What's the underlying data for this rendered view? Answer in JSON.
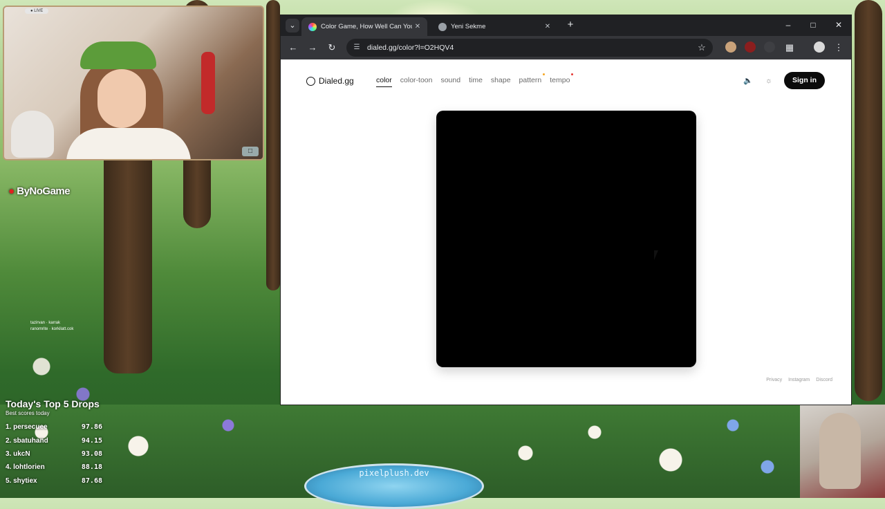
{
  "stream": {
    "live_badge": "● LIVE",
    "brand": "ByNoGame",
    "chat": [
      "tazirvan · karrak",
      "ranomrite · korkilatt.cok"
    ],
    "pool_label": "pixelplush.dev",
    "leaderboard": {
      "title": "Today's Top 5 Drops",
      "subtitle": "Best scores today",
      "rows": [
        {
          "rank": "1.",
          "name": "persecuee",
          "score": "97.86"
        },
        {
          "rank": "2.",
          "name": "sbatuhand",
          "score": "94.15"
        },
        {
          "rank": "3.",
          "name": "ukcN",
          "score": "93.08"
        },
        {
          "rank": "4.",
          "name": "lohtlorien",
          "score": "88.18"
        },
        {
          "rank": "5.",
          "name": "shytiex",
          "score": "87.68"
        }
      ]
    }
  },
  "browser": {
    "tabs": [
      {
        "label": "Color Game, How Well Can You",
        "active": true
      },
      {
        "label": "Yeni Sekme",
        "active": false
      }
    ],
    "url": "dialed.gg/color?l=O2HQV4",
    "icons": {
      "tab_search": "chevron-down-icon",
      "new_tab": "plus-icon",
      "minimize": "minimize-icon",
      "maximize": "maximize-icon",
      "close": "close-icon",
      "back": "back-arrow-icon",
      "forward": "forward-arrow-icon",
      "reload": "reload-icon",
      "bookmark": "star-icon",
      "extensions": "puzzle-icon",
      "menu": "kebab-menu-icon"
    }
  },
  "site": {
    "logo_text": "Dialed.gg",
    "nav": [
      {
        "label": "color",
        "active": true,
        "dot": ""
      },
      {
        "label": "color-toon",
        "active": false,
        "dot": ""
      },
      {
        "label": "sound",
        "active": false,
        "dot": ""
      },
      {
        "label": "time",
        "active": false,
        "dot": ""
      },
      {
        "label": "shape",
        "active": false,
        "dot": ""
      },
      {
        "label": "pattern",
        "active": false,
        "dot": "#f5a623"
      },
      {
        "label": "tempo",
        "active": false,
        "dot": "#e53935"
      }
    ],
    "sign_in": "Sign in",
    "game_color": "#000000",
    "footer": [
      "Privacy",
      "Instagram",
      "Discord"
    ]
  }
}
